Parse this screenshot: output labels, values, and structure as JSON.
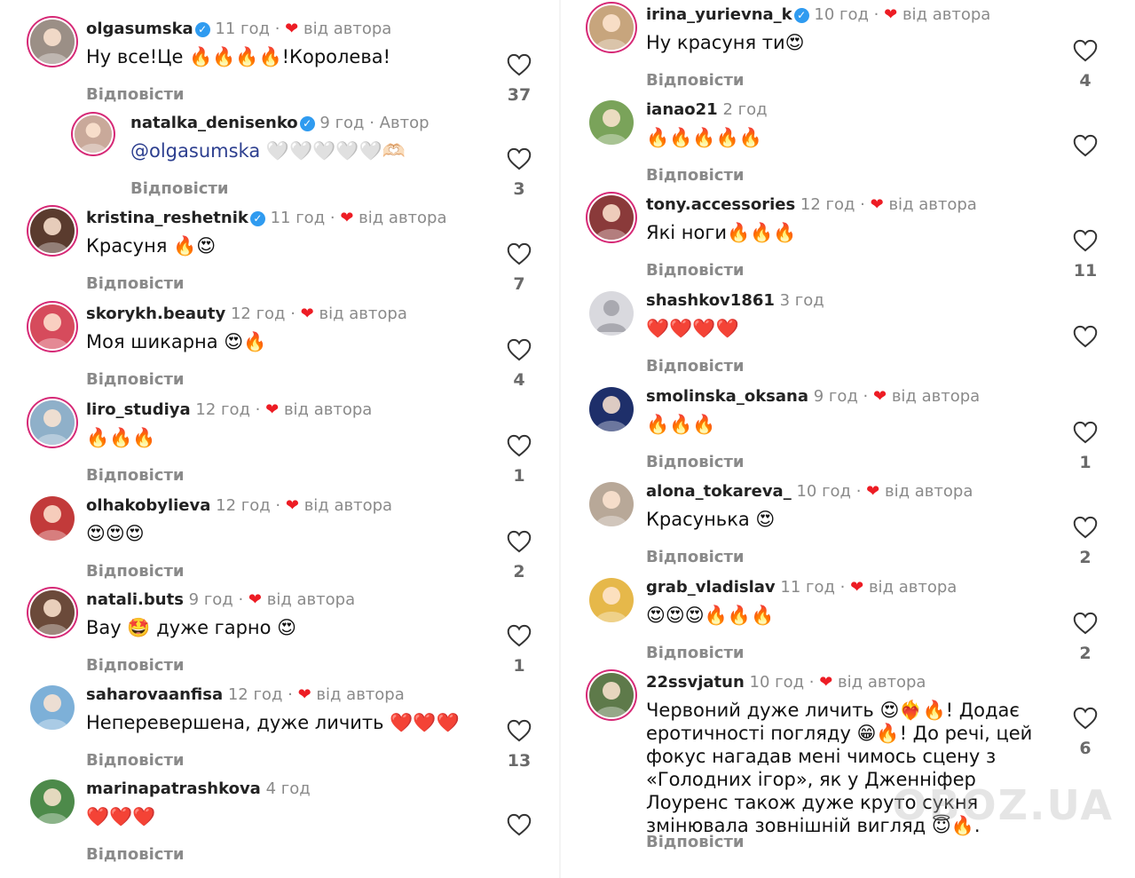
{
  "reply_label": "Відповісти",
  "watermark": "OBOZ.UA",
  "colors": {
    "heart": "#ed1c24",
    "verified": "#2f9bf0",
    "story_ring": "#d62976",
    "mention": "#2d3f8f"
  },
  "left_comments": [
    {
      "username": "olgasumska",
      "verified": true,
      "time": "11 год",
      "liked_by_author": true,
      "liked_label": "від автора",
      "text": "Ну все!Це 🔥🔥🔥🔥!Королева!",
      "likes": "37"
    },
    {
      "username": "natalka_denisenko",
      "verified": true,
      "time": "9 год",
      "author_badge": "Автор",
      "mention": "@olgasumska",
      "text": " 🤍🤍🤍🤍🤍🫶🏻",
      "likes": "3"
    },
    {
      "username": "kristina_reshetnik",
      "verified": true,
      "time": "11 год",
      "liked_by_author": true,
      "liked_label": "від автора",
      "text": "Красуня 🔥😍",
      "likes": "7"
    },
    {
      "username": "skorykh.beauty",
      "time": "12 год",
      "liked_by_author": true,
      "liked_label": "від автора",
      "text": "Моя шикарна 😍🔥",
      "likes": "4"
    },
    {
      "username": "liro_studiya",
      "time": "12 год",
      "liked_by_author": true,
      "liked_label": "від автора",
      "text": "🔥🔥🔥",
      "likes": "1"
    },
    {
      "username": "olhakobylieva",
      "time": "12 год",
      "liked_by_author": true,
      "liked_label": "від автора",
      "text": "😍😍😍",
      "likes": "2"
    },
    {
      "username": "natali.buts",
      "time": "9 год",
      "liked_by_author": true,
      "liked_label": "від автора",
      "text": "Вау 🤩 дуже гарно 😍",
      "likes": "1"
    },
    {
      "username": "saharovaanfisa",
      "time": "12 год",
      "liked_by_author": true,
      "liked_label": "від автора",
      "text": "Неперевершена, дуже личить ❤️❤️❤️",
      "likes": "13"
    },
    {
      "username": "marinapatrashkova",
      "time": "4 год",
      "text": "❤️❤️❤️",
      "likes": ""
    }
  ],
  "right_comments": [
    {
      "username": "irina_yurievna_k",
      "verified": true,
      "time": "10 год",
      "liked_by_author": true,
      "liked_label": "від автора",
      "text": "Ну красуня ти😍",
      "likes": "4"
    },
    {
      "username": "ianao21",
      "time": "2 год",
      "text": "🔥🔥🔥🔥🔥",
      "likes": ""
    },
    {
      "username": "tony.accessories",
      "time": "12 год",
      "liked_by_author": true,
      "liked_label": "від автора",
      "text": "Які ноги🔥🔥🔥",
      "likes": "11"
    },
    {
      "username": "shashkov1861",
      "time": "3 год",
      "text": "❤️❤️❤️❤️",
      "likes": ""
    },
    {
      "username": "smolinska_oksana",
      "time": "9 год",
      "liked_by_author": true,
      "liked_label": "від автора",
      "text": "🔥🔥🔥",
      "likes": "1"
    },
    {
      "username": "alona_tokareva_",
      "time": "10 год",
      "liked_by_author": true,
      "liked_label": "від автора",
      "text": "Красунька 😍",
      "likes": "2"
    },
    {
      "username": "grab_vladislav",
      "time": "11 год",
      "liked_by_author": true,
      "liked_label": "від автора",
      "text": "😍😍😍🔥🔥🔥",
      "likes": "2"
    },
    {
      "username": "22ssvjatun",
      "time": "10 год",
      "liked_by_author": true,
      "liked_label": "від автора",
      "text_lines": [
        "Червоний дуже личить 😍❤️‍🔥🔥! Додає",
        "еротичності погляду 😁🔥! До речі, цей",
        "фокус нагадав мені чимось сцену з",
        "«Голодних ігор», як у Дженніфер",
        "Лоуренс також дуже круто сукня",
        "змінювала зовнішній вигляд 😇🔥."
      ],
      "likes": "6"
    }
  ]
}
